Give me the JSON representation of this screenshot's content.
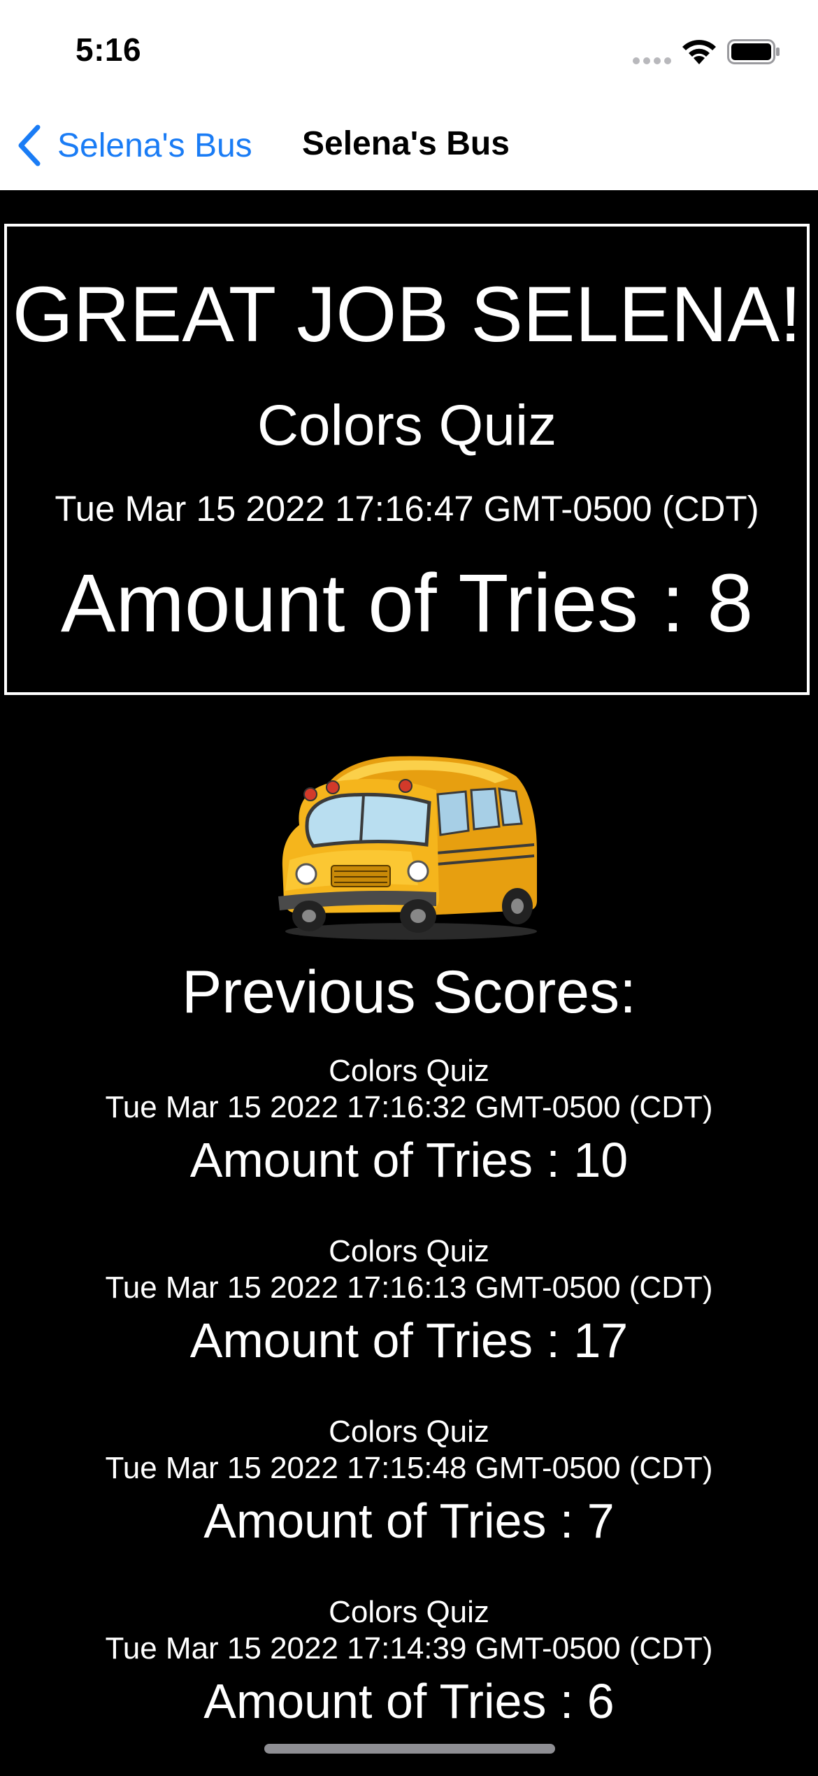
{
  "status_bar": {
    "time": "5:16"
  },
  "nav": {
    "back_label": "Selena's Bus",
    "title": "Selena's Bus"
  },
  "result": {
    "headline": "GREAT JOB SELENA!",
    "quiz_name": "Colors Quiz",
    "date": "Tue Mar 15 2022 17:16:47 GMT-0500 (CDT)",
    "tries": "Amount of Tries : 8"
  },
  "bus_image": "school-bus-icon",
  "previous": {
    "heading": "Previous Scores:",
    "scores": [
      {
        "quiz": "Colors Quiz",
        "date": "Tue Mar 15 2022 17:16:32 GMT-0500 (CDT)",
        "tries": "Amount of Tries : 10"
      },
      {
        "quiz": "Colors Quiz",
        "date": "Tue Mar 15 2022 17:16:13 GMT-0500 (CDT)",
        "tries": "Amount of Tries : 17"
      },
      {
        "quiz": "Colors Quiz",
        "date": "Tue Mar 15 2022 17:15:48 GMT-0500 (CDT)",
        "tries": "Amount of Tries : 7"
      },
      {
        "quiz": "Colors Quiz",
        "date": "Tue Mar 15 2022 17:14:39 GMT-0500 (CDT)",
        "tries": "Amount of Tries : 6"
      }
    ]
  },
  "colors": {
    "accent": "#1a7cf5",
    "background": "#000000",
    "header_background": "#ffffff",
    "bus_yellow": "#f5b51c"
  }
}
